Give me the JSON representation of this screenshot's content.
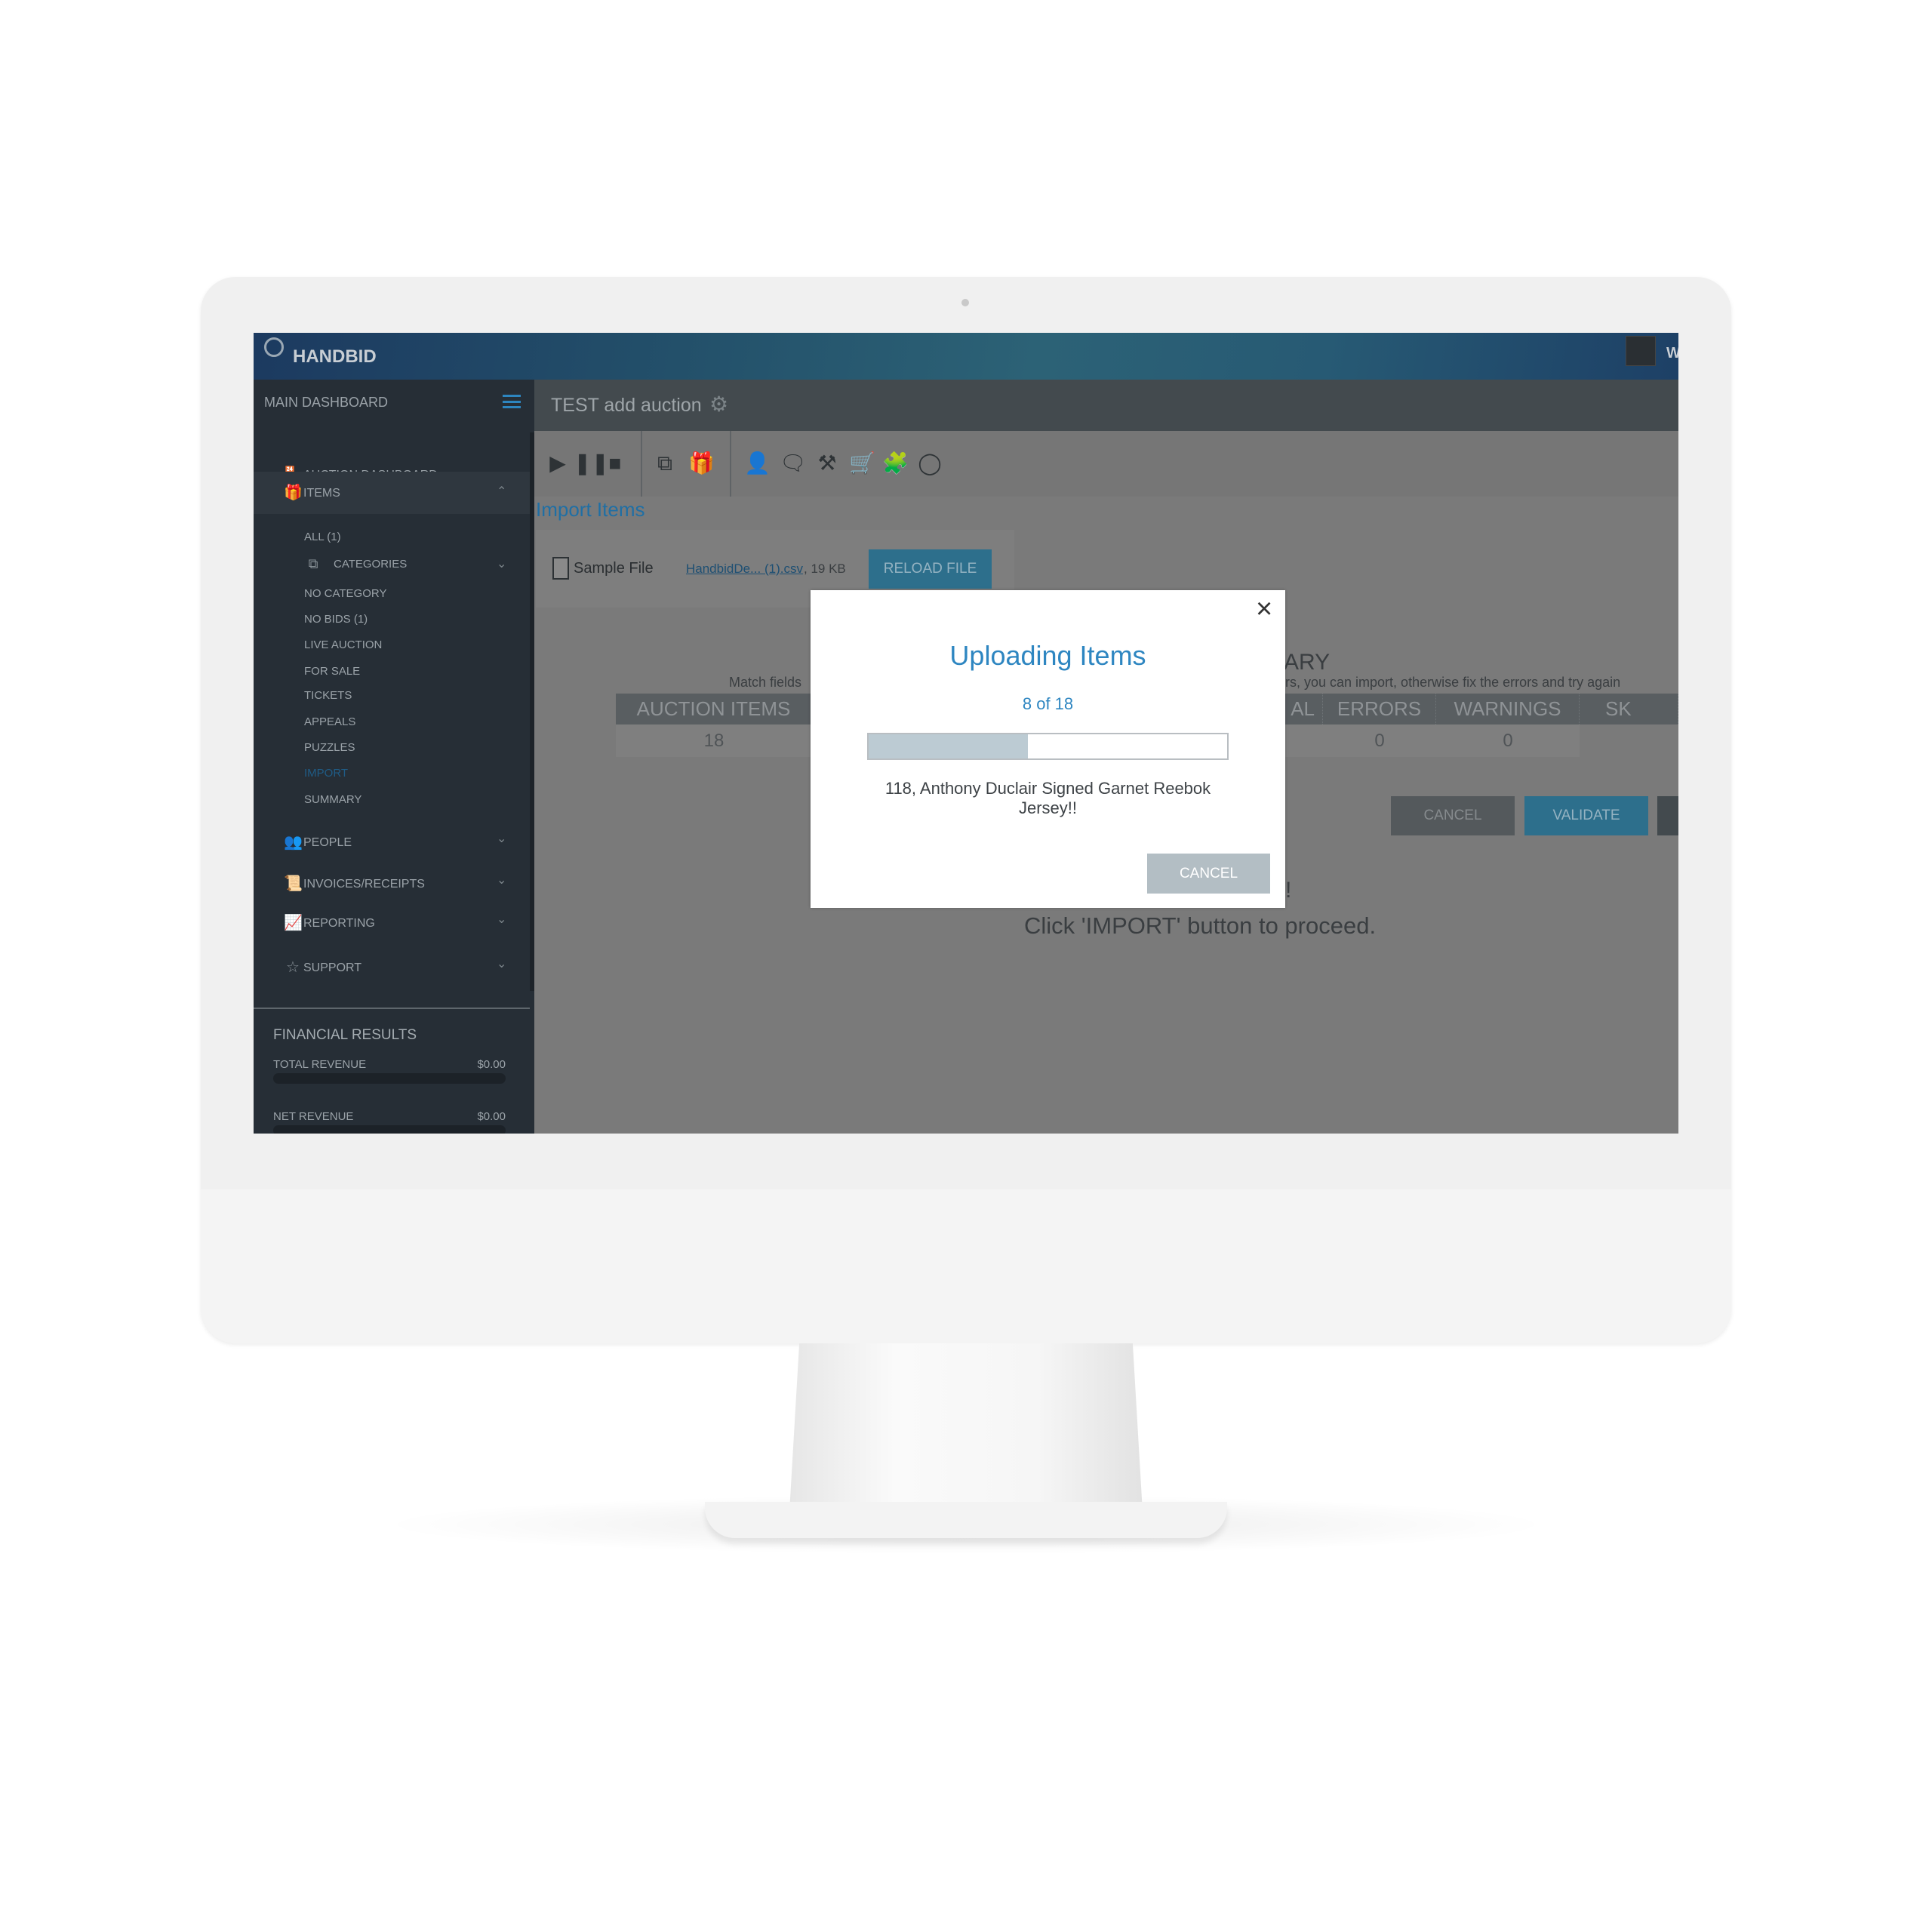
{
  "header": {
    "logo": "HANDBID",
    "user_initial": "W"
  },
  "sidebar": {
    "title": "MAIN DASHBOARD",
    "auction_dashboard": "AUCTION DASHBOARD",
    "items": "ITEMS",
    "sub": [
      "ALL (1)",
      "CATEGORIES",
      "NO CATEGORY",
      "NO BIDS (1)",
      "LIVE AUCTION",
      "FOR SALE",
      "TICKETS",
      "APPEALS",
      "PUZZLES",
      "IMPORT",
      "SUMMARY"
    ],
    "people": "PEOPLE",
    "invoices": "INVOICES/RECEIPTS",
    "reporting": "REPORTING",
    "support": "SUPPORT",
    "financial": {
      "title": "FINANCIAL RESULTS",
      "total_label": "TOTAL REVENUE",
      "total_value": "$0.00",
      "net_label": "NET REVENUE",
      "net_value": "$0.00"
    }
  },
  "titlebar": {
    "title": "TEST add auction"
  },
  "page": {
    "heading": "Import Items",
    "sample_file": "Sample File",
    "file_link": "HandbidDe... (1).csv",
    "file_size": ", 19 KB",
    "reload": "RELOAD FILE",
    "summary_fragment": "ARY",
    "match_fields": "Match fields",
    "hint_fragment": "rs, you can import, otherwise fix the errors and try again",
    "table": {
      "headers": [
        "AUCTION ITEMS",
        "AL",
        "ERRORS",
        "WARNINGS",
        "SK"
      ],
      "values": [
        "18",
        "",
        "0",
        "0",
        ""
      ]
    },
    "cancel": "CANCEL",
    "validate": "VALIDATE",
    "exclaim": "!",
    "proceed": "Click 'IMPORT' button to proceed."
  },
  "modal": {
    "title": "Uploading Items",
    "count": "8 of 18",
    "progress": {
      "current": 8,
      "total": 18
    },
    "item_line1": "118, Anthony Duclair Signed Garnet Reebok",
    "item_line2": "Jersey!!",
    "cancel": "CANCEL"
  },
  "colors": {
    "accent": "#2e86c1",
    "button_blue": "#2d6f8c",
    "active_nav": "#1f5c86"
  }
}
